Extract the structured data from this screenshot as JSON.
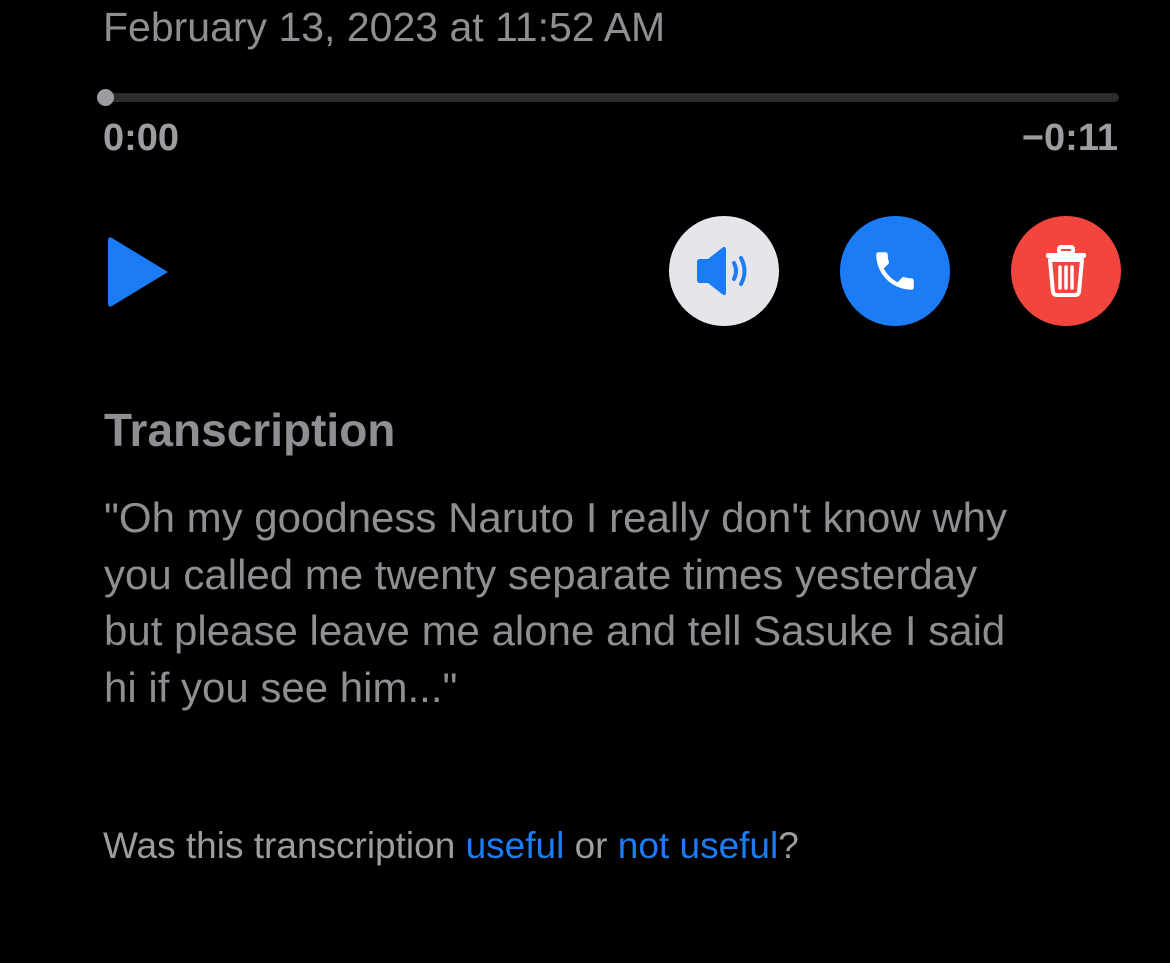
{
  "voicemail": {
    "timestamp": "February 13, 2023 at 11:52 AM"
  },
  "player": {
    "progress": 0,
    "elapsed": "0:00",
    "remaining": "−0:11"
  },
  "actions": {
    "play_icon": "play-icon",
    "speaker_icon": "speaker-icon",
    "call_icon": "phone-icon",
    "delete_icon": "trash-icon"
  },
  "transcription": {
    "title": "Transcription",
    "text": "\"Oh my goodness Naruto I really don't know why you called me twenty separate times yesterday but please leave me alone and tell Sasuke I said hi if you see him...\"",
    "feedback_prefix": "Was this transcription ",
    "useful_label": "useful",
    "feedback_or": " or ",
    "not_useful_label": "not useful",
    "feedback_suffix": "?"
  },
  "colors": {
    "background": "#000000",
    "text_secondary": "#8e8e93",
    "accent_blue": "#1c7cf5",
    "destructive_red": "#f2453d",
    "speaker_button_bg": "#e5e5ea"
  }
}
